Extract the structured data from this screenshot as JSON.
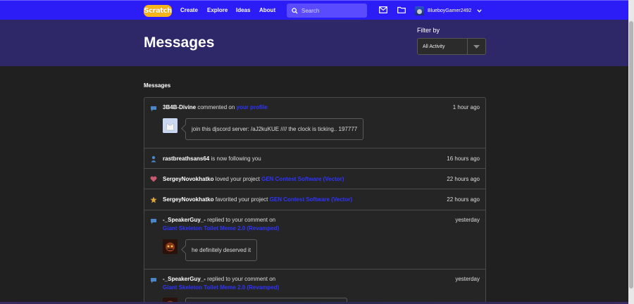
{
  "nav": {
    "logo_text": "Scratch",
    "links": [
      "Create",
      "Explore",
      "Ideas",
      "About"
    ],
    "search_placeholder": "Search",
    "username": "BlueboyGamer2492",
    "accent_color": "#2c1cf5"
  },
  "header": {
    "title": "Messages",
    "filter_label": "Filter by",
    "filter_value": "All Activity"
  },
  "section_title": "Messages",
  "messages": [
    {
      "icon": "comment-icon",
      "user": "3B4B-Divine",
      "action": "commented on",
      "target": "your profile",
      "time": "1 hour ago",
      "comment": "join this djscord server: /aJ2kuKUE //// the clock is ticking.. 197777"
    },
    {
      "icon": "follow-icon",
      "user": "rastbreathsans64",
      "action": "is now following you",
      "time": "16 hours ago"
    },
    {
      "icon": "heart-icon",
      "user": "SergeyNovokhatko",
      "action": "loved your project",
      "target": "GEN Contest Software (Vector)",
      "time": "22 hours ago"
    },
    {
      "icon": "star-icon",
      "user": "SergeyNovokhatko",
      "action": "favorited your project",
      "target": "GEN Contest Software (Vector)",
      "time": "22 hours ago"
    },
    {
      "icon": "comment-icon",
      "user": "-_SpeakerGuy_-",
      "action": "replied to your comment on",
      "target": "Giant Skeleton Toilet Meme 2.0 (Revamped)",
      "time": "yesterday",
      "comment": "he definitely deserved it"
    },
    {
      "icon": "comment-icon",
      "user": "-_SpeakerGuy_-",
      "action": "replied to your comment on",
      "target": "Giant Skeleton Toilet Meme 2.0 (Revamped)",
      "time": "yesterday"
    }
  ]
}
